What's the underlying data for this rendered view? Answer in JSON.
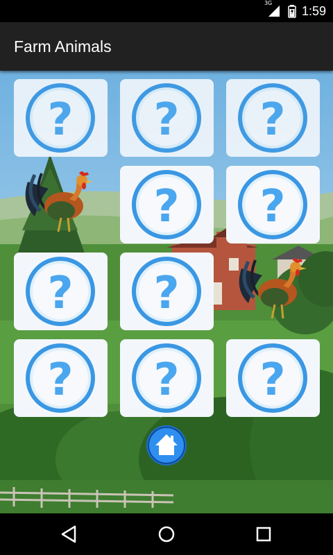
{
  "status_bar": {
    "network": "3G",
    "time": "1:59",
    "icons": [
      "signal-icon",
      "battery-icon"
    ]
  },
  "app_bar": {
    "title": "Farm Animals"
  },
  "cards": [
    {
      "state": "hidden",
      "icon": "question-mark-icon"
    },
    {
      "state": "hidden",
      "icon": "question-mark-icon"
    },
    {
      "state": "hidden",
      "icon": "question-mark-icon"
    },
    {
      "state": "revealed",
      "animal": "rooster"
    },
    {
      "state": "hidden",
      "icon": "question-mark-icon"
    },
    {
      "state": "hidden",
      "icon": "question-mark-icon"
    },
    {
      "state": "hidden",
      "icon": "question-mark-icon"
    },
    {
      "state": "hidden",
      "icon": "question-mark-icon"
    },
    {
      "state": "revealed",
      "animal": "rooster"
    },
    {
      "state": "hidden",
      "icon": "question-mark-icon"
    },
    {
      "state": "hidden",
      "icon": "question-mark-icon"
    },
    {
      "state": "hidden",
      "icon": "question-mark-icon"
    }
  ],
  "home_button": {
    "icon": "home-icon"
  },
  "nav_bar": {
    "items": [
      "back-icon",
      "home-circle-icon",
      "recents-icon"
    ]
  },
  "colors": {
    "status_bar": "#000000",
    "app_bar": "#212121",
    "accent": "#2a8fe0",
    "card": "#f3f7fc"
  }
}
